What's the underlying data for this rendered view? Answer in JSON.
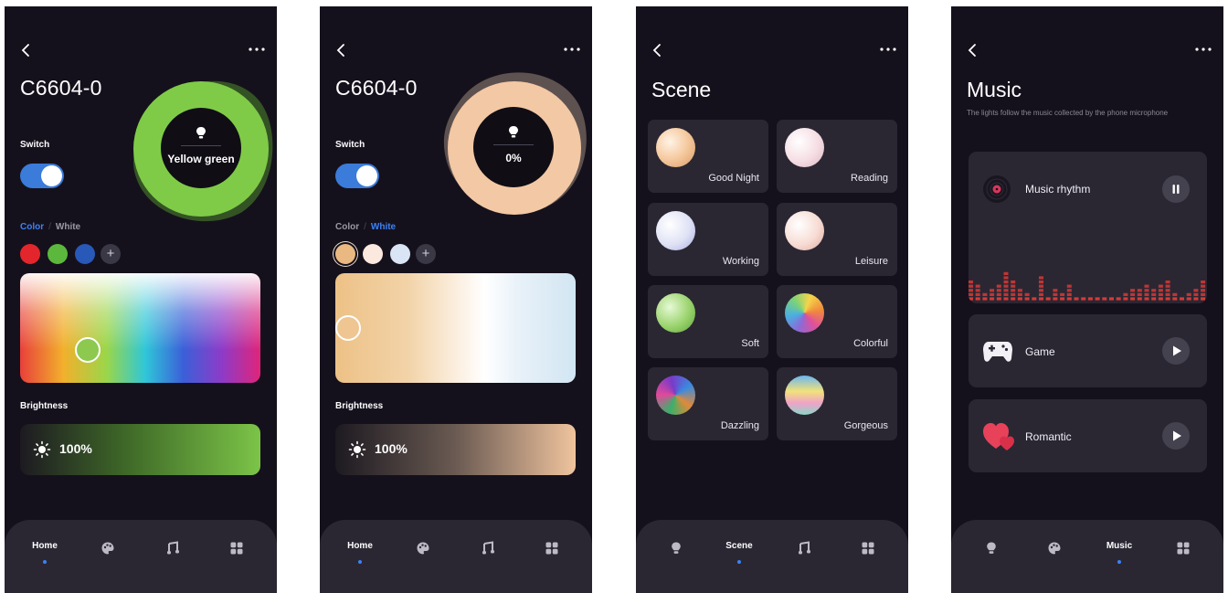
{
  "screens": [
    {
      "device_name": "C6604-0",
      "switch_label": "Switch",
      "tab_color": "Color",
      "tab_white": "White",
      "center_text": "Yellow green",
      "brightness_label": "Brightness",
      "brightness_value": "100%",
      "swatch_colors": [
        "#e3262c",
        "#5cb83c",
        "#2858b8"
      ],
      "add_icon": "+"
    },
    {
      "device_name": "C6604-0",
      "switch_label": "Switch",
      "tab_color": "Color",
      "tab_white": "White",
      "center_text": "0%",
      "brightness_label": "Brightness",
      "brightness_value": "100%",
      "swatch_colors": [
        "#eab982",
        "#fbe8de",
        "#d9e5f5"
      ],
      "add_icon": "+"
    }
  ],
  "scene": {
    "title": "Scene",
    "items": [
      "Good Night",
      "Reading",
      "Working",
      "Leisure",
      "Soft",
      "Colorful",
      "Dazzling",
      "Gorgeous"
    ]
  },
  "music": {
    "title": "Music",
    "description": "The lights follow the music collected by the phone microphone",
    "items": [
      "Music rhythm",
      "Game",
      "Romantic"
    ]
  },
  "nav": {
    "home": "Home",
    "scene": "Scene",
    "music": "Music"
  },
  "colors": {
    "background": "#15111c",
    "card": "#2a2733",
    "accent": "#3b82f6",
    "toggle": "#3b7bd9",
    "eq_bar": "#d83a36"
  }
}
